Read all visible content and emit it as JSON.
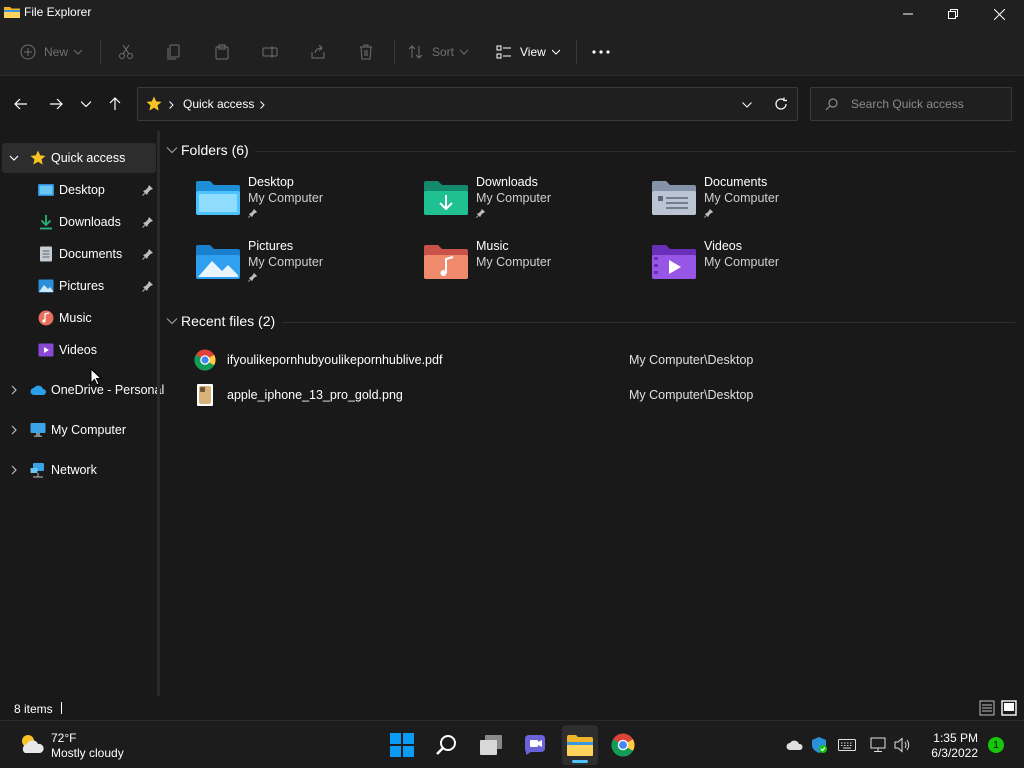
{
  "window": {
    "title": "File Explorer"
  },
  "toolbar": {
    "new_label": "New",
    "sort_label": "Sort",
    "view_label": "View"
  },
  "address": {
    "crumb": "Quick access"
  },
  "search": {
    "placeholder": "Search Quick access"
  },
  "sidebar": {
    "items": [
      {
        "label": "Quick access",
        "icon": "star-icon"
      },
      {
        "label": "Desktop",
        "icon": "desktop-icon",
        "pinned": true
      },
      {
        "label": "Downloads",
        "icon": "download-icon",
        "pinned": true
      },
      {
        "label": "Documents",
        "icon": "documents-icon",
        "pinned": true
      },
      {
        "label": "Pictures",
        "icon": "pictures-icon",
        "pinned": true
      },
      {
        "label": "Music",
        "icon": "music-icon"
      },
      {
        "label": "Videos",
        "icon": "videos-icon"
      },
      {
        "label": "OneDrive - Personal",
        "icon": "cloud-icon"
      },
      {
        "label": "My Computer",
        "icon": "monitor-icon"
      },
      {
        "label": "Network",
        "icon": "network-icon"
      }
    ]
  },
  "folders_section": {
    "heading": "Folders (6)",
    "items": [
      {
        "name": "Desktop",
        "location": "My Computer",
        "pinned": true
      },
      {
        "name": "Downloads",
        "location": "My Computer",
        "pinned": true
      },
      {
        "name": "Documents",
        "location": "My Computer",
        "pinned": true
      },
      {
        "name": "Pictures",
        "location": "My Computer",
        "pinned": true
      },
      {
        "name": "Music",
        "location": "My Computer",
        "pinned": false
      },
      {
        "name": "Videos",
        "location": "My Computer",
        "pinned": false
      }
    ]
  },
  "recent_section": {
    "heading": "Recent files (2)",
    "items": [
      {
        "name": "ifyoulikepornhubyoulikepornhublive.pdf",
        "path": "My Computer\\Desktop",
        "icon": "chrome-icon"
      },
      {
        "name": "apple_iphone_13_pro_gold.png",
        "path": "My Computer\\Desktop",
        "icon": "image-thumbnail-icon"
      }
    ]
  },
  "status": {
    "item_count": "8 items"
  },
  "taskbar": {
    "weather_temp": "72°F",
    "weather_desc": "Mostly cloudy",
    "time": "1:35 PM",
    "date": "6/3/2022",
    "notification_count": "1"
  },
  "colors": {
    "folder_blue": "#4cc2ff",
    "accent": "#0078d4"
  }
}
